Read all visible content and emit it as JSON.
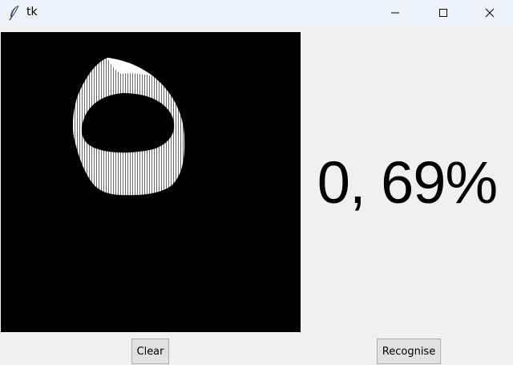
{
  "window": {
    "title": "tk",
    "icon": "feather-icon",
    "controls": {
      "minimize_icon": "minimize-icon",
      "maximize_icon": "maximize-icon",
      "close_icon": "close-icon"
    }
  },
  "canvas": {
    "background": "#000000",
    "stroke_color": "#ffffff"
  },
  "result": {
    "text": "0, 69%"
  },
  "buttons": {
    "clear_label": "Clear",
    "recognise_label": "Recognise"
  }
}
